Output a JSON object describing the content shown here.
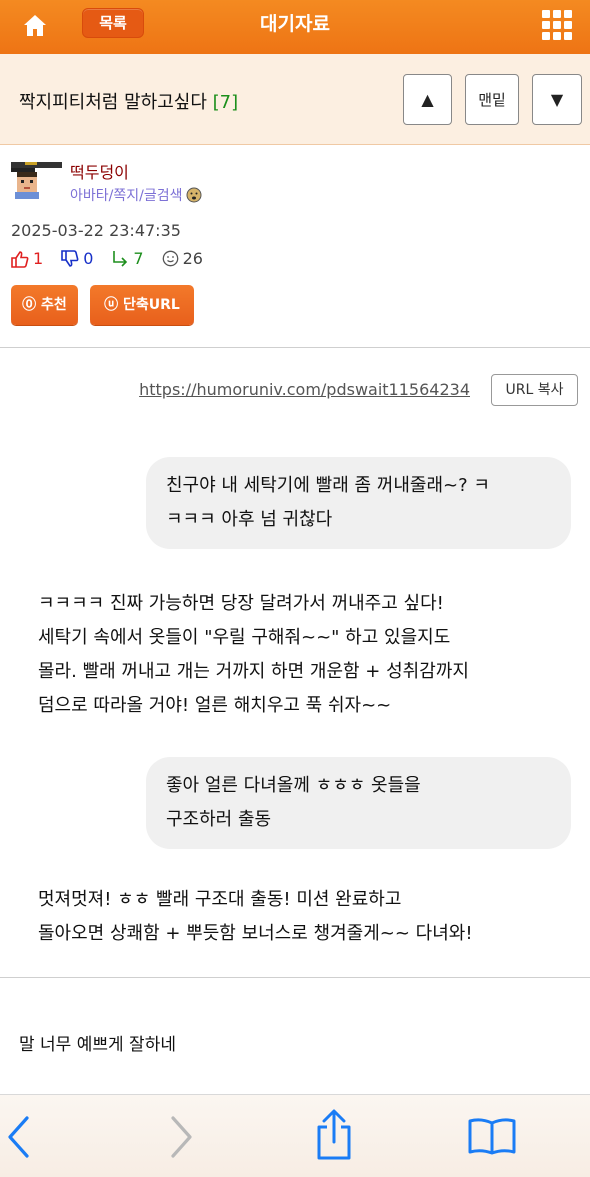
{
  "topbar": {
    "home_icon": "home-icon",
    "list_label": "목록",
    "title": "대기자료",
    "menu_icon": "grid-menu-icon",
    "bg_color": "#ef7818"
  },
  "post": {
    "title": "짝지피티처럼 말하고싶다",
    "comment_count": "[7]",
    "nav_up": "▲",
    "nav_bottom": "맨밑",
    "nav_down": "▼"
  },
  "author": {
    "name": "떡두덩이",
    "links": "아바타/쪽지/글검색",
    "date": "2025-03-22 23:47:35"
  },
  "stats": {
    "likes": "1",
    "dislikes": "0",
    "replies": "7",
    "views": "26"
  },
  "buttons": {
    "recommend": "⓪ 추천",
    "short_url": "ⓤ 단축URL",
    "copy_url": "URL 복사"
  },
  "short_url": "https://humoruniv.com/pdswait11564234",
  "chat": {
    "bubble1": [
      "친구야 내 세탁기에 빨래 좀 꺼내줄래~? ㅋ",
      "ㅋㅋㅋ 아후 넘 귀찮다"
    ],
    "reply1": [
      "ㅋㅋㅋㅋ 진짜 가능하면 당장 달려가서 꺼내주고 싶다!",
      "세탁기 속에서 옷들이 \"우릴 구해줘~~\" 하고 있을지도",
      "몰라. 빨래 꺼내고 개는 거까지 하면 개운함 + 성취감까지",
      "덤으로 따라올 거야! 얼른 해치우고 푹 쉬자~~"
    ],
    "bubble2": [
      "좋아 얼른 다녀올께 ㅎㅎㅎ 옷들을",
      "구조하러 출동"
    ],
    "reply2": [
      "멋져멋져! ㅎㅎ 빨래 구조대 출동! 미션 완료하고",
      "돌아오면 상쾌함 + 뿌듯함 보너스로 챙겨줄게~~ 다녀와!"
    ]
  },
  "comment_text": "말 너무 예쁘게 잘하네",
  "toolbar": {
    "back_icon": "back-chevron-icon",
    "forward_icon": "forward-chevron-icon",
    "share_icon": "share-icon",
    "bookmarks_icon": "bookmarks-icon"
  }
}
